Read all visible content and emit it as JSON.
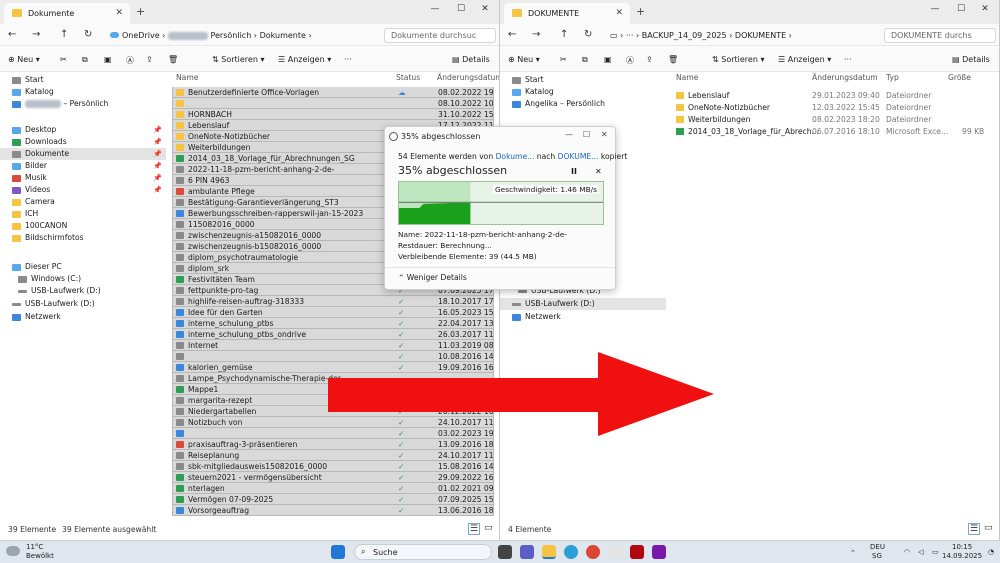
{
  "left": {
    "tab_title": "Dokumente",
    "breadcrumb": [
      "OneDrive",
      "Persönlich",
      "Dokumente"
    ],
    "search_placeholder": "Dokumente durchsuc",
    "cmd": {
      "new": "Neu",
      "sort": "Sortieren",
      "view": "Anzeigen",
      "details": "Details"
    },
    "headers": {
      "name": "Name",
      "status": "Status",
      "date": "Änderungsdatum"
    },
    "nav": {
      "start": "Start",
      "catalog": "Katalog",
      "personal": "– Persönlich",
      "desktop": "Desktop",
      "downloads": "Downloads",
      "documents": "Dokumente",
      "pictures": "Bilder",
      "music": "Musik",
      "videos": "Videos",
      "camera": "Camera",
      "ich": "ICH",
      "canon": "100CANON",
      "screenshots": "Bildschirmfotos",
      "thispc": "Dieser PC",
      "windows": "Windows (C:)",
      "usb1": "USB-Laufwerk (D:)",
      "usb2": "USB-Laufwerk (D:)",
      "network": "Netzwerk"
    },
    "files": [
      {
        "name": "Benutzerdefinierte Office-Vorlagen",
        "status": "cloud",
        "date": "08.02.2022 19:0",
        "icon": "folder"
      },
      {
        "name": "",
        "status": "",
        "date": "08.10.2022 10:0",
        "icon": "folder"
      },
      {
        "name": "HORNBACH",
        "status": "",
        "date": "31.10.2022 15:1",
        "icon": "folder"
      },
      {
        "name": "Lebenslauf",
        "status": "",
        "date": "17.12.2022 11:0",
        "icon": "folder"
      },
      {
        "name": "OneNote-Notizbücher",
        "status": "",
        "date": "",
        "icon": "folder"
      },
      {
        "name": "Weiterbildungen",
        "status": "",
        "date": "",
        "icon": "folder"
      },
      {
        "name": "2014_03_18_Vorlage_für_Abrechnungen_SG",
        "status": "",
        "date": "",
        "icon": "excel"
      },
      {
        "name": "2022-11-18-pzm-bericht-anhang-2-de-",
        "status": "",
        "date": "",
        "icon": "doc"
      },
      {
        "name": "6                  PIN 4963",
        "status": "",
        "date": "",
        "icon": "doc"
      },
      {
        "name": "ambulante Pflege",
        "status": "",
        "date": "",
        "icon": "pdf"
      },
      {
        "name": "Bestätigung-Garantieverlängerung_ST3",
        "status": "",
        "date": "",
        "icon": "doc"
      },
      {
        "name": "Bewerbungsschreiben-rapperswil-jan-15-2023",
        "status": "",
        "date": "",
        "icon": "word"
      },
      {
        "name": "115082016_0000",
        "status": "",
        "date": "",
        "icon": "doc"
      },
      {
        "name": "zwischenzeugnis-a15082016_0000",
        "status": "",
        "date": "",
        "icon": "doc"
      },
      {
        "name": "zwischenzeugnis-b15082016_0000",
        "status": "",
        "date": "",
        "icon": "doc"
      },
      {
        "name": "diplom_psychotraumatologie",
        "status": "",
        "date": "",
        "icon": "doc"
      },
      {
        "name": "diplom_srk",
        "status": "",
        "date": "",
        "icon": "doc"
      },
      {
        "name": "Festivitäten Team",
        "status": "",
        "date": "",
        "icon": "excel"
      },
      {
        "name": "fettpunkte-pro-tag",
        "status": "check",
        "date": "07.09.2025 17:5",
        "icon": "doc"
      },
      {
        "name": "highlife-reisen-auftrag-318333",
        "status": "check",
        "date": "18.10.2017 17:0",
        "icon": "doc"
      },
      {
        "name": "Idee für den Garten",
        "status": "check",
        "date": "16.05.2023 15:5",
        "icon": "word"
      },
      {
        "name": "interne_schulung_ptbs",
        "status": "check",
        "date": "22.04.2017 13:4",
        "icon": "word"
      },
      {
        "name": "interne_schulung_ptbs_ondrive",
        "status": "check",
        "date": "26.03.2017 11:3",
        "icon": "word"
      },
      {
        "name": "Internet",
        "status": "check",
        "date": "11.03.2019 08:2",
        "icon": "doc"
      },
      {
        "name": "",
        "status": "check",
        "date": "10.08.2016 14:3",
        "icon": "doc"
      },
      {
        "name": "kalorien_gemüse",
        "status": "check",
        "date": "19.09.2016 16:5",
        "icon": "word"
      },
      {
        "name": "Lampe_Psychodynamische-Therapie-der",
        "status": "",
        "date": "",
        "icon": "doc"
      },
      {
        "name": "Mappe1",
        "status": "",
        "date": "",
        "icon": "excel"
      },
      {
        "name": "margarita-rezept",
        "status": "",
        "date": "",
        "icon": "doc"
      },
      {
        "name": "Niedergartabellen",
        "status": "check",
        "date": "20.12.2022 16:3",
        "icon": "doc"
      },
      {
        "name": "Notizbuch von",
        "status": "check",
        "date": "24.10.2017 11:2",
        "icon": "doc"
      },
      {
        "name": "",
        "status": "check",
        "date": "03.02.2023 19:1",
        "icon": "word"
      },
      {
        "name": "praxisauftrag-3-präsentieren",
        "status": "check",
        "date": "13.09.2016 18:2",
        "icon": "pdf"
      },
      {
        "name": "Reiseplanung",
        "status": "check",
        "date": "24.10.2017 11:3",
        "icon": "doc"
      },
      {
        "name": "sbk-mitgliedausweis15082016_0000",
        "status": "check",
        "date": "15.08.2016 14:0",
        "icon": "doc"
      },
      {
        "name": "steuern2021 - vermögensübersicht",
        "status": "check",
        "date": "29.09.2022 16:4",
        "icon": "excel"
      },
      {
        "name": "nterlagen",
        "status": "check",
        "date": "01.02.2021 09:1",
        "icon": "excel"
      },
      {
        "name": "Vermögen 07-09-2025",
        "status": "check",
        "date": "07.09.2025 15:5",
        "icon": "excel"
      },
      {
        "name": "Vorsorgeauftrag",
        "status": "check",
        "date": "13.06.2016 18:4",
        "icon": "word"
      }
    ],
    "status_count": "39 Elemente",
    "status_selected": "39 Elemente ausgewählt"
  },
  "right": {
    "tab_title": "DOKUMENTE",
    "breadcrumb": [
      "BACKUP_14_09_2025",
      "DOKUMENTE"
    ],
    "search_placeholder": "DOKUMENTE durchs",
    "cmd": {
      "new": "Neu",
      "sort": "Sortieren",
      "view": "Anzeigen",
      "details": "Details"
    },
    "headers": {
      "name": "Name",
      "date": "Änderungsdatum",
      "type": "Typ",
      "size": "Größe"
    },
    "nav": {
      "start": "Start",
      "catalog": "Katalog",
      "personal": "Angelika – Persönlich",
      "usb1": "USB-Laufwerk (D:)",
      "usb2": "USB-Laufwerk (D:)",
      "network": "Netzwerk"
    },
    "files": [
      {
        "name": "Lebenslauf",
        "date": "29.01.2023 09:40",
        "type": "Dateiordner",
        "size": "",
        "icon": "folder"
      },
      {
        "name": "OneNote-Notizbücher",
        "date": "12.03.2022 15:45",
        "type": "Dateiordner",
        "size": "",
        "icon": "folder"
      },
      {
        "name": "Weiterbildungen",
        "date": "08.02.2023 18:20",
        "type": "Dateiordner",
        "size": "",
        "icon": "folder"
      },
      {
        "name": "2014_03_18_Vorlage_für_Abrech...",
        "date": "06.07.2016 18:10",
        "type": "Microsoft Exce...",
        "size": "99 KB",
        "icon": "excel"
      }
    ],
    "status_count": "4 Elemente"
  },
  "dialog": {
    "title": "35% abgeschlossen",
    "line1_pre": "54 Elemente werden von",
    "line1_from": "Dokume...",
    "line1_mid": "nach",
    "line1_to": "DOKUME...",
    "line1_post": "kopiert",
    "headline": "35% abgeschlossen",
    "speed": "Geschwindigkeit: 1.46 MB/s",
    "progress": 0.35,
    "name_line": "Name: 2022-11-18-pzm-bericht-anhang-2-de-",
    "rest_line": "Restdauer: Berechnung...",
    "remaining_line": "Verbleibende Elemente: 39 (44.5 MB)",
    "less": "Weniger Details"
  },
  "taskbar": {
    "temp": "11°C",
    "weather": "Bewölkt",
    "search": "Suche",
    "lang": "DEU",
    "region": "SG",
    "time": "10:15",
    "date": "14.09.2025"
  },
  "colors": {
    "arrow": "#f01010",
    "progress": "#1aa01a",
    "accent": "#1668c1"
  }
}
